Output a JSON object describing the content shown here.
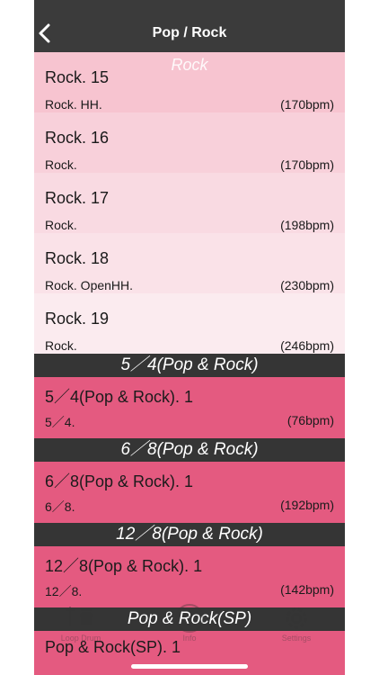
{
  "nav": {
    "title": "Pop / Rock",
    "back_icon": "chevron-left-icon"
  },
  "sticky_section": "Rock",
  "colors": {
    "navbar": "#3b3b3b",
    "section_header": "#353535",
    "rock_row_shades": [
      "#f7c4d0",
      "#f8d0da",
      "#f9dae2",
      "#fae2e8",
      "#fbebef"
    ],
    "accent_row": "#e45a80"
  },
  "rock_rows": [
    {
      "title": "Rock. 15",
      "sub": "Rock. HH.",
      "bpm": "(170bpm)"
    },
    {
      "title": "Rock. 16",
      "sub": "Rock.",
      "bpm": "(170bpm)"
    },
    {
      "title": "Rock. 17",
      "sub": "Rock.",
      "bpm": "(198bpm)"
    },
    {
      "title": "Rock. 18",
      "sub": "Rock. OpenHH.",
      "bpm": "(230bpm)"
    },
    {
      "title": "Rock. 19",
      "sub": "Rock.",
      "bpm": "(246bpm)"
    }
  ],
  "sections": [
    {
      "header": "5／4(Pop & Rock)",
      "row": {
        "title": "5／4(Pop & Rock). 1",
        "sub": "5／4.",
        "bpm": "(76bpm)"
      }
    },
    {
      "header": "6／8(Pop & Rock)",
      "row": {
        "title": "6／8(Pop & Rock). 1",
        "sub": "6／8.",
        "bpm": "(192bpm)"
      }
    },
    {
      "header": "12／8(Pop & Rock)",
      "row": {
        "title": "12／8(Pop & Rock). 1",
        "sub": "12／8.",
        "bpm": "(142bpm)"
      }
    },
    {
      "header": "Pop & Rock(SP)",
      "row": {
        "title": "Pop & Rock(SP). 1"
      }
    }
  ],
  "tabbar": {
    "items": [
      {
        "label": "Loop Drum",
        "icon": "drum-kit-icon"
      },
      {
        "label": "Info",
        "icon": "info-icon"
      },
      {
        "label": "Settings",
        "icon": "gear-icon"
      }
    ]
  }
}
